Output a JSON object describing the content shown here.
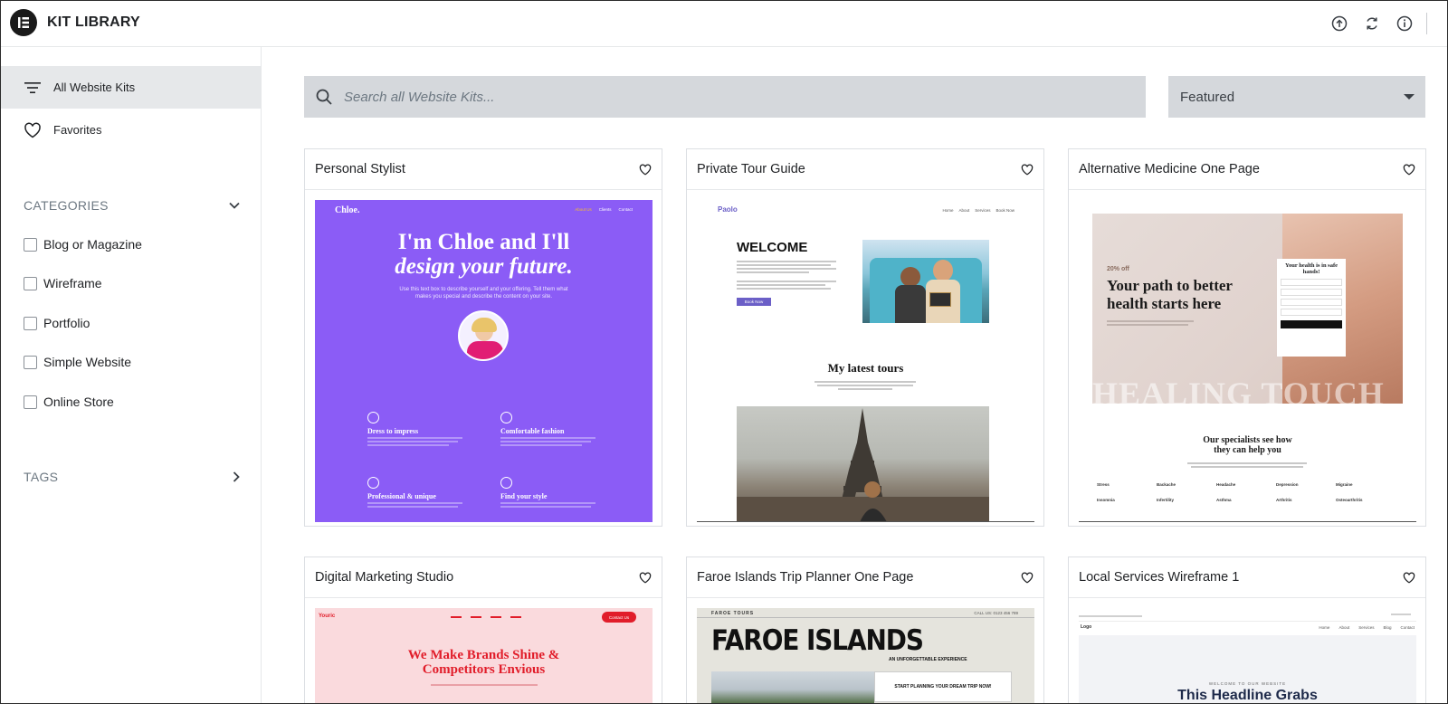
{
  "header": {
    "title": "KIT LIBRARY",
    "icons": [
      "import-icon",
      "sync-icon",
      "info-icon"
    ]
  },
  "sidebar": {
    "nav": [
      {
        "label": "All Website Kits",
        "icon": "filter-lines-icon",
        "active": true
      },
      {
        "label": "Favorites",
        "icon": "heart-icon",
        "active": false
      }
    ],
    "categories_label": "CATEGORIES",
    "categories": [
      "Blog or Magazine",
      "Wireframe",
      "Portfolio",
      "Simple Website",
      "Online Store"
    ],
    "tags_label": "TAGS"
  },
  "search": {
    "placeholder": "Search all Website Kits..."
  },
  "sort": {
    "selected": "Featured"
  },
  "cards": [
    {
      "title": "Personal Stylist",
      "preview": {
        "brand": "Chloe.",
        "nav": [
          "About Us",
          "Clients",
          "Contact"
        ],
        "headline1": "I'm Chloe and I'll",
        "headline2": "design your future.",
        "body": "Use this text box to describe yourself and your offering. Tell them what makes you special and describe the content on your site.",
        "features": [
          "Dress to impress",
          "Comfortable fashion",
          "Professional & unique",
          "Find your style"
        ]
      }
    },
    {
      "title": "Private Tour Guide",
      "preview": {
        "brand": "Paolo",
        "nav": [
          "Home",
          "About",
          "Services",
          "Book Now"
        ],
        "welcome": "WELCOME",
        "button": "Book Now",
        "tours_title": "My latest tours"
      }
    },
    {
      "title": "Alternative Medicine One Page",
      "preview": {
        "discount": "20% off",
        "headline": "Your path to better health starts here",
        "form_title": "Your health is in safe hands!",
        "watermark": "HEALING TOUCH",
        "specialists": "Our specialists see how they can help you",
        "conditions": [
          "Stress",
          "Backache",
          "Headache",
          "Depression",
          "Migraine",
          "Insomnia",
          "Infertility",
          "Asthma",
          "Arthritis",
          "Osteoarthritis"
        ]
      }
    },
    {
      "title": "Digital Marketing Studio",
      "preview": {
        "brand": "Youric",
        "button": "Contact Us",
        "headline": "We Make Brands Shine & Competitors Envious"
      }
    },
    {
      "title": "Faroe Islands Trip Planner One Page",
      "preview": {
        "brand": "FAROE TOURS",
        "phone": "CALL US: 0123 456 789",
        "headline": "FAROE ISLANDS",
        "tagline": "AN UNFORGETTABLE EXPERIENCE",
        "cta": "START PLANNING YOUR DREAM TRIP NOW!"
      }
    },
    {
      "title": "Local Services Wireframe 1",
      "preview": {
        "logo": "Logo",
        "nav": [
          "Home",
          "About",
          "Services",
          "Blog",
          "Contact"
        ],
        "welcome": "WELCOME TO OUR WEBSITE",
        "headline": "This Headline Grabs"
      }
    }
  ],
  "colors": {
    "accent_purple": "#8b5cf6",
    "sidebar_active": "#e6e8ea",
    "search_bg": "#d5d8dc",
    "marketing_red": "#e11d2a"
  }
}
